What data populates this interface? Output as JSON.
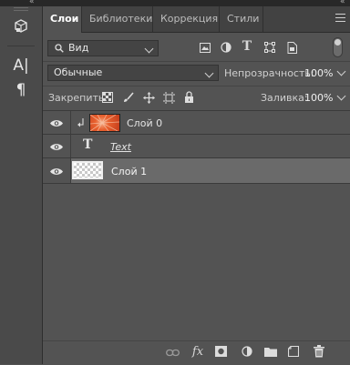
{
  "collapse_glyph": "«",
  "toolbar": {
    "tools": [
      {
        "name": "3d-cube-icon",
        "glyph": ""
      },
      {
        "name": "character-icon",
        "glyph": "A|"
      },
      {
        "name": "paragraph-icon",
        "glyph": "¶"
      }
    ]
  },
  "tabs": [
    {
      "label": "Слои",
      "active": true
    },
    {
      "label": "Библиотеки",
      "active": false
    },
    {
      "label": "Коррекция",
      "active": false
    },
    {
      "label": "Стили",
      "active": false
    }
  ],
  "filter": {
    "kind_label": "Вид",
    "icons": [
      "image-filter-icon",
      "adjustment-filter-icon",
      "text-filter-icon",
      "shape-filter-icon",
      "smart-object-filter-icon"
    ]
  },
  "blend": {
    "mode": "Обычные",
    "opacity_label": "Непрозрачность:",
    "opacity_value": "100%"
  },
  "lock": {
    "label": "Закрепить:",
    "fill_label": "Заливка:",
    "fill_value": "100%"
  },
  "layers": [
    {
      "name": "Слой 0",
      "type": "image",
      "clipped": true,
      "selected": false,
      "visible": true
    },
    {
      "name": "Text",
      "type": "text",
      "clipped": false,
      "selected": false,
      "visible": true
    },
    {
      "name": "Слой 1",
      "type": "transparent",
      "clipped": false,
      "selected": true,
      "visible": true
    }
  ],
  "colors": {
    "panel_bg": "#535353",
    "selected_layer": "#6a6a6a",
    "thumb_orange": "#e8612f"
  }
}
